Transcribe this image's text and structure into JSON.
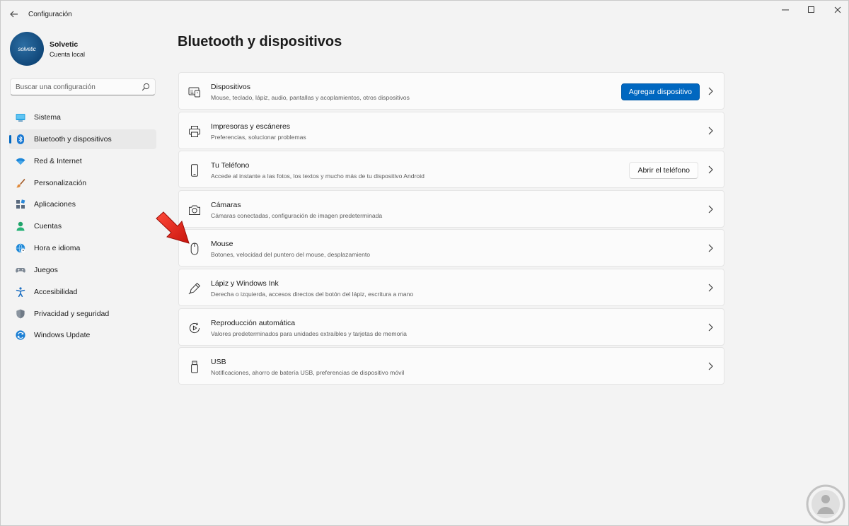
{
  "window": {
    "title": "Configuración",
    "controls": {
      "minimize": "minimize-icon",
      "maximize": "maximize-icon",
      "close": "close-icon"
    }
  },
  "profile": {
    "avatar_text": "solvetic",
    "name": "Solvetic",
    "account_type": "Cuenta local"
  },
  "search": {
    "placeholder": "Buscar una configuración",
    "value": ""
  },
  "sidebar": {
    "items": [
      {
        "label": "Sistema",
        "icon": "system-icon",
        "active": false
      },
      {
        "label": "Bluetooth y dispositivos",
        "icon": "bluetooth-icon",
        "active": true
      },
      {
        "label": "Red & Internet",
        "icon": "wifi-icon",
        "active": false
      },
      {
        "label": "Personalización",
        "icon": "brush-icon",
        "active": false
      },
      {
        "label": "Aplicaciones",
        "icon": "apps-icon",
        "active": false
      },
      {
        "label": "Cuentas",
        "icon": "person-icon",
        "active": false
      },
      {
        "label": "Hora e idioma",
        "icon": "globe-clock-icon",
        "active": false
      },
      {
        "label": "Juegos",
        "icon": "gamepad-icon",
        "active": false
      },
      {
        "label": "Accesibilidad",
        "icon": "accessibility-icon",
        "active": false
      },
      {
        "label": "Privacidad y seguridad",
        "icon": "shield-icon",
        "active": false
      },
      {
        "label": "Windows Update",
        "icon": "update-icon",
        "active": false
      }
    ]
  },
  "main": {
    "title": "Bluetooth y dispositivos",
    "cards": [
      {
        "title": "Dispositivos",
        "description": "Mouse, teclado, lápiz, audio, pantallas y acoplamientos, otros dispositivos",
        "icon": "devices-icon",
        "button": "Agregar dispositivo"
      },
      {
        "title": "Impresoras y escáneres",
        "description": "Preferencias, solucionar problemas",
        "icon": "printer-icon"
      },
      {
        "title": "Tu Teléfono",
        "description": "Accede al instante a las fotos, los textos y mucho más de tu dispositivo Android",
        "icon": "phone-icon",
        "button": "Abrir el teléfono"
      },
      {
        "title": "Cámaras",
        "description": "Cámaras conectadas, configuración de imagen predeterminada",
        "icon": "camera-icon"
      },
      {
        "title": "Mouse",
        "description": "Botones, velocidad del puntero del mouse, desplazamiento",
        "icon": "mouse-icon"
      },
      {
        "title": "Lápiz y Windows Ink",
        "description": "Derecha o izquierda, accesos directos del botón del lápiz, escritura a mano",
        "icon": "pen-icon"
      },
      {
        "title": "Reproducción automática",
        "description": "Valores predeterminados para unidades extraíbles y tarjetas de memoria",
        "icon": "autoplay-icon"
      },
      {
        "title": "USB",
        "description": "Notificaciones, ahorro de batería USB, preferencias de dispositivo móvil",
        "icon": "usb-icon"
      }
    ]
  },
  "colors": {
    "accent": "#0067c0",
    "background": "#f3f3f3",
    "card": "#fbfbfb",
    "annotation_arrow": "#e8251c"
  }
}
